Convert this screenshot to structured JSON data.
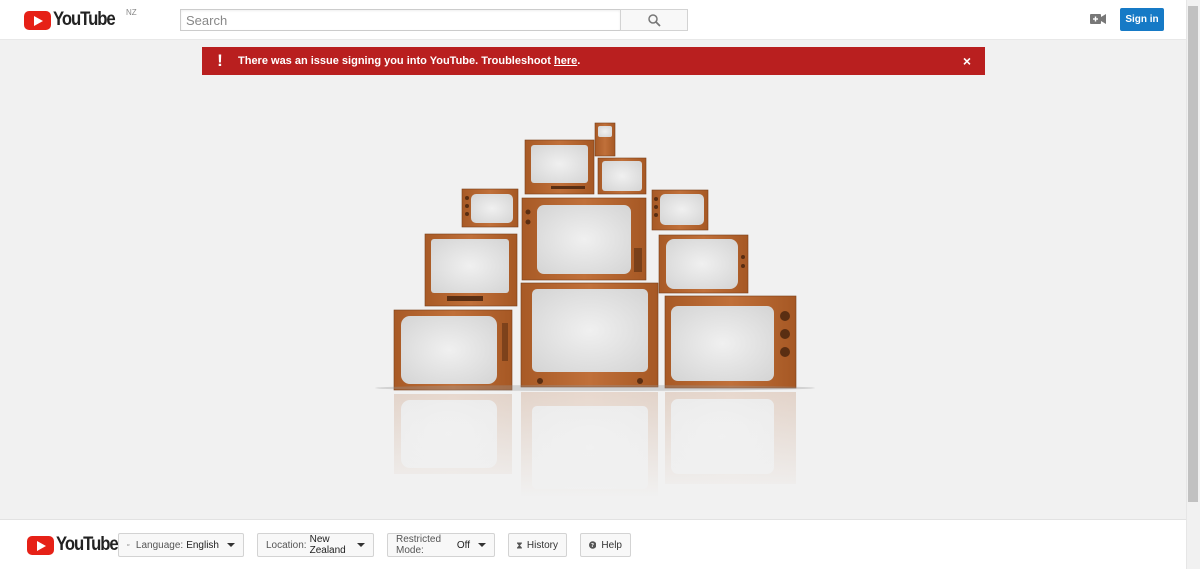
{
  "header": {
    "logo_text": "YouTube",
    "country_code": "NZ",
    "search_placeholder": "Search",
    "signin_label": "Sign in"
  },
  "alert": {
    "message": "There was an issue signing you into YouTube. Troubleshoot ",
    "link_text": "here",
    "message_end": ".",
    "close": "×",
    "color": "#b91f1f"
  },
  "footer": {
    "logo_text": "YouTube",
    "language_label": "Language:",
    "language_value": "English",
    "location_label": "Location:",
    "location_value": "New Zealand",
    "restricted_label": "Restricted Mode:",
    "restricted_value": "Off",
    "history_label": "History",
    "help_label": "Help"
  },
  "colors": {
    "brand_red": "#e62117",
    "signin_blue": "#167ac6",
    "tv_wood": "#b5652e"
  }
}
